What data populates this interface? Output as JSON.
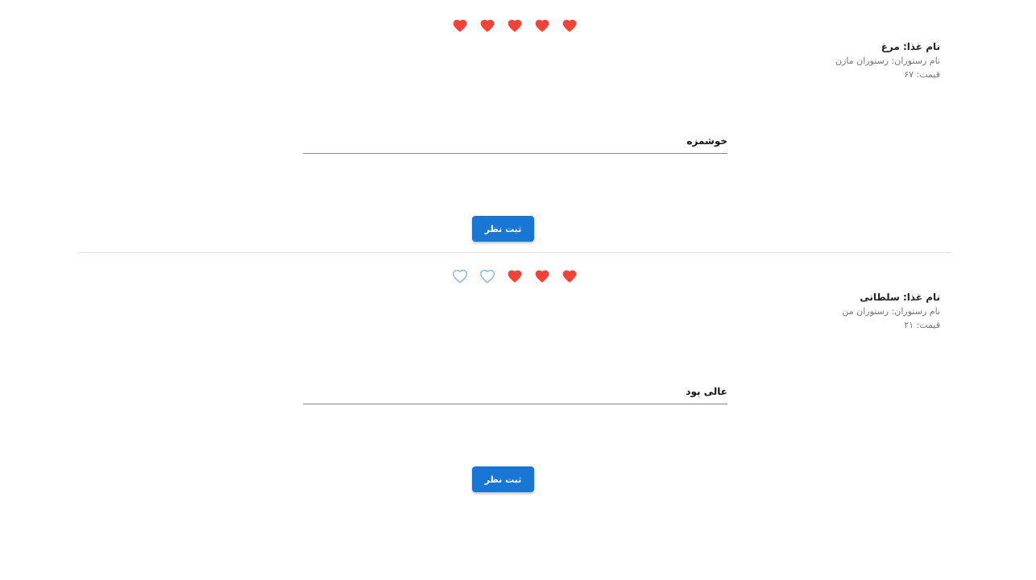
{
  "colors": {
    "heart_filled": "#f44336",
    "heart_empty": "#90b8f0",
    "button_bg": "#1976d2",
    "divider": "#e0e0e0"
  },
  "reviews": [
    {
      "food_name": "نام غذا: مرغ",
      "restaurant": "نام رستوران: رستوران مازن",
      "price": "قیمت: ۶۷",
      "rating": 5,
      "rating_max": 5,
      "comment_value": "خوشمزه",
      "submit_label": "ثبت نظر"
    },
    {
      "food_name": "نام غذا: سلطانی",
      "restaurant": "نام رستوران: رستوران من",
      "price": "قیمت: ۲۱",
      "rating": 3,
      "rating_max": 5,
      "comment_value": "عالی بود",
      "submit_label": "ثبت نظر"
    }
  ]
}
